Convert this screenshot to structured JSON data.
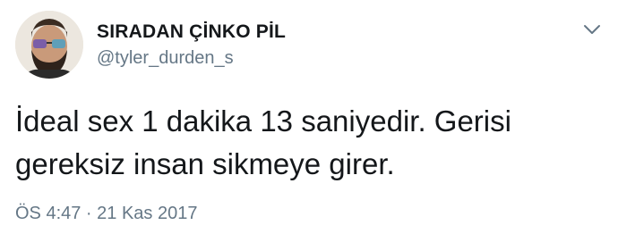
{
  "tweet": {
    "author": {
      "display_name": "SIRADAN ÇİNKO PİL",
      "handle": "@tyler_durden_s",
      "avatar_icon": "profile-photo"
    },
    "menu_icon": "chevron-down-icon",
    "text": "İdeal sex 1 dakika 13 saniyedir. Gerisi\ngereksiz insan sikmeye girer.",
    "timestamp": "ÖS 4:47 · 21 Kas 2017"
  },
  "colors": {
    "primary_text": "#14171a",
    "secondary_text": "#657786",
    "chevron": "#657786",
    "background": "#ffffff"
  }
}
